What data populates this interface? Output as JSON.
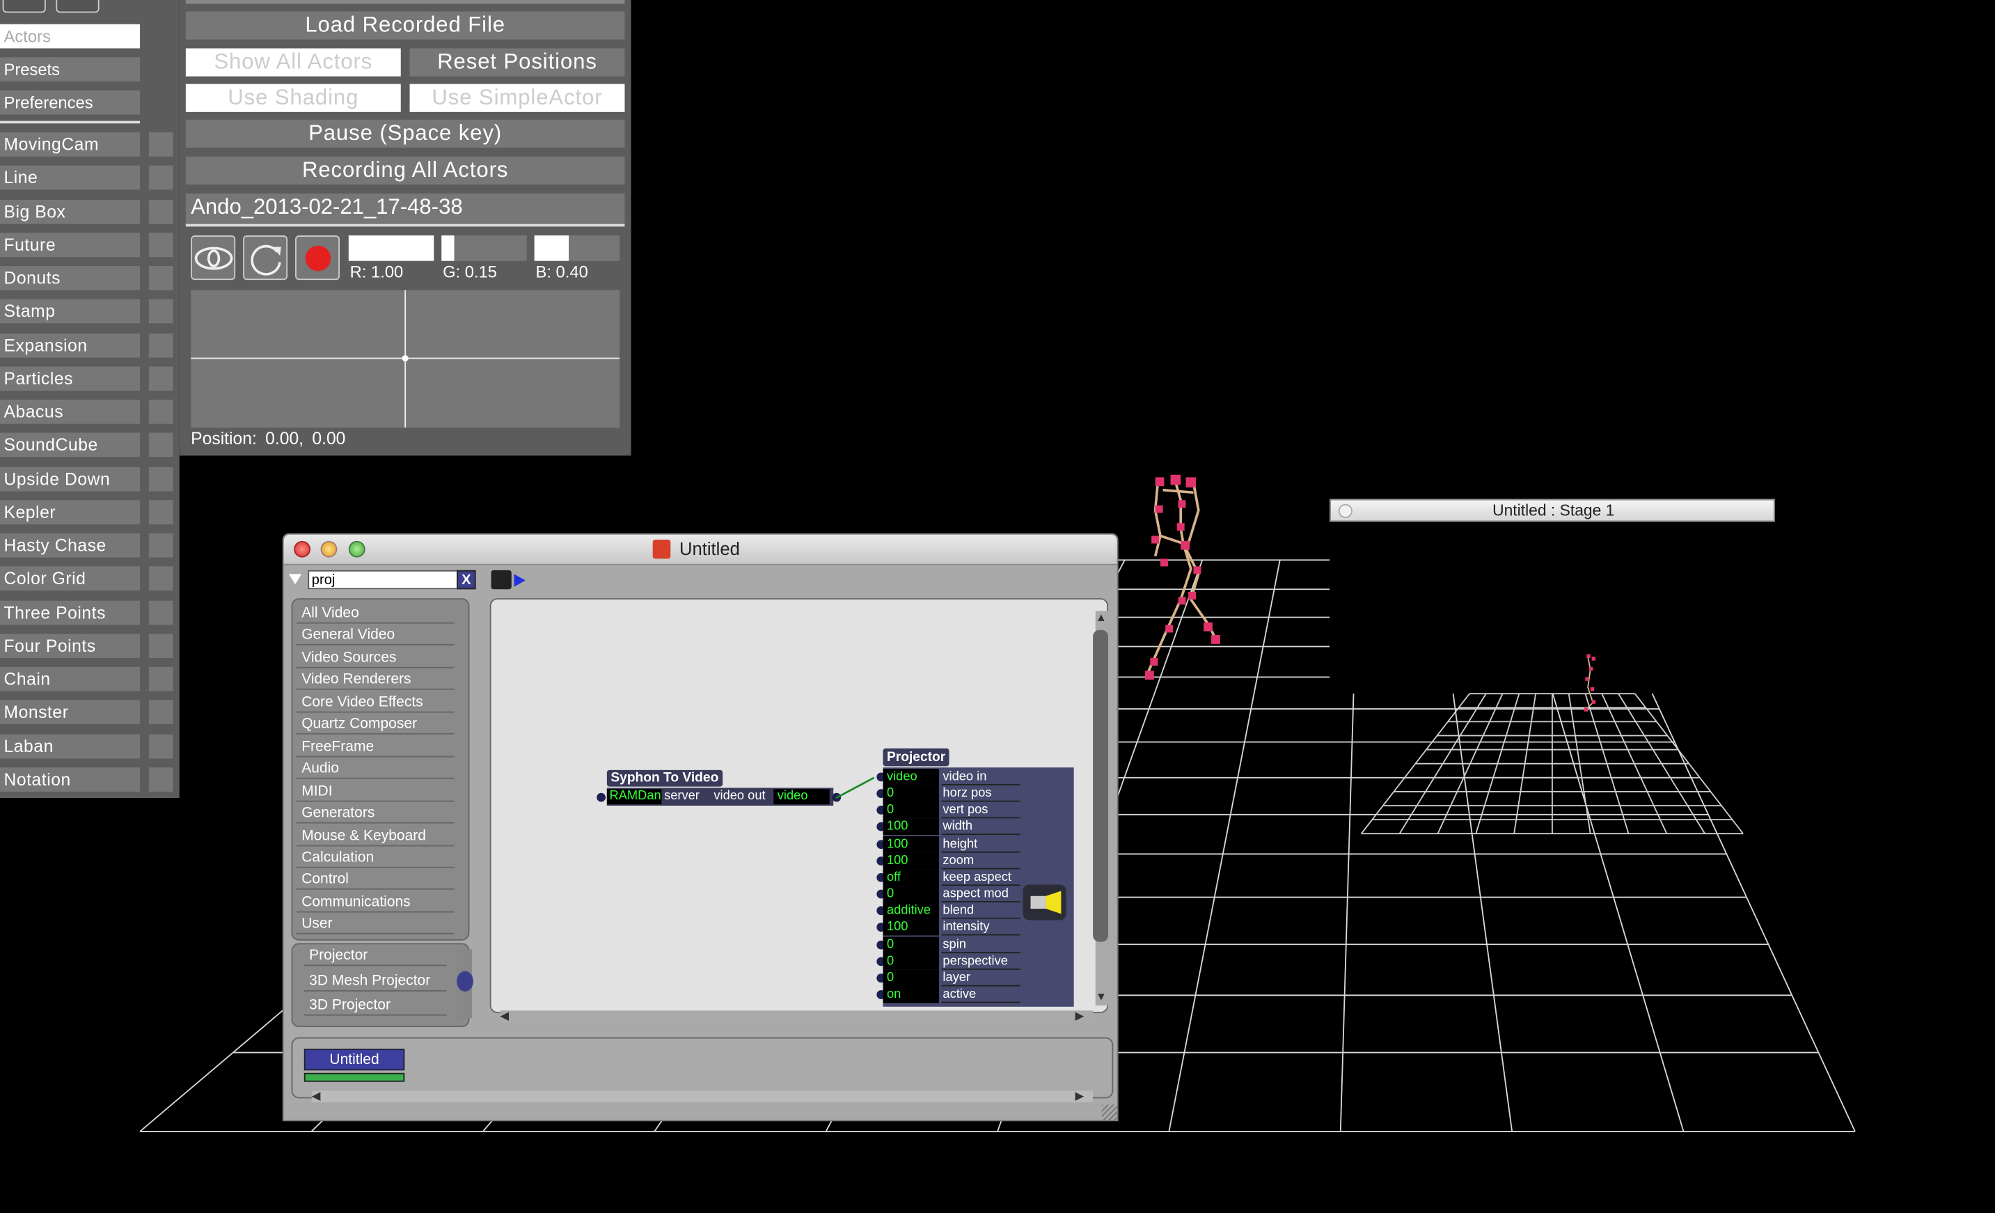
{
  "sidebar": {
    "top_items": [
      "Actors",
      "Presets",
      "Preferences"
    ],
    "actors": [
      "MovingCam",
      "Line",
      "Big Box",
      "Future",
      "Donuts",
      "Stamp",
      "Expansion",
      "Particles",
      "Abacus",
      "SoundCube",
      "Upside Down",
      "Kepler",
      "Hasty Chase",
      "Color Grid",
      "Three Points",
      "Four Points",
      "Chain",
      "Monster",
      "Laban",
      "Notation"
    ]
  },
  "control_panel": {
    "load_recorded": "Load Recorded File",
    "show_all_actors": "Show All Actors",
    "reset_positions": "Reset Positions",
    "use_shading": "Use Shading",
    "use_simpleactor": "Use SimpleActor",
    "pause": "Pause (Space key)",
    "recording": "Recording All Actors",
    "recording_name": "Ando_2013-02-21_17-48-38",
    "r_label": "R: 1.00",
    "g_label": "G: 0.15",
    "b_label": "B: 0.40",
    "r_value": 1.0,
    "g_value": 0.15,
    "b_value": 0.4,
    "position_label": "Position: 0.00, 0.00",
    "record_color": "#e52020"
  },
  "patch_window": {
    "title": "Untitled",
    "search_value": "proj",
    "clear_label": "X",
    "categories": [
      "All Video",
      "General Video",
      "Video Sources",
      "Video Renderers",
      "Core Video Effects",
      "Quartz Composer",
      "FreeFrame",
      "Audio",
      "MIDI",
      "Generators",
      "Mouse & Keyboard",
      "Calculation",
      "Control",
      "Communications",
      "User"
    ],
    "results": [
      "Projector",
      "3D Mesh Projector",
      "3D Projector"
    ],
    "scene_tab": "Untitled",
    "syphon": {
      "title": "Syphon To Video",
      "server_value": "RAMDan",
      "server_label": "server",
      "out_label": "video out",
      "out_value": "video"
    },
    "projector": {
      "title": "Projector",
      "ports": [
        {
          "value": "video",
          "name": "video in"
        },
        {
          "value": "0",
          "name": "horz pos"
        },
        {
          "value": "0",
          "name": "vert pos"
        },
        {
          "value": "100",
          "name": "width"
        },
        {
          "value": "100",
          "name": "height"
        },
        {
          "value": "100",
          "name": "zoom"
        },
        {
          "value": "off",
          "name": "keep aspect"
        },
        {
          "value": "0",
          "name": "aspect mod"
        },
        {
          "value": "additive",
          "name": "blend"
        },
        {
          "value": "100",
          "name": "intensity"
        },
        {
          "value": "0",
          "name": "spin"
        },
        {
          "value": "0",
          "name": "perspective"
        },
        {
          "value": "0",
          "name": "layer"
        },
        {
          "value": "on",
          "name": "active"
        }
      ]
    }
  },
  "stage_window": {
    "title": "Untitled : Stage 1"
  },
  "colors": {
    "figure": "#e0336b",
    "bones": "#d8b48a",
    "port_value": "#33ff33"
  }
}
